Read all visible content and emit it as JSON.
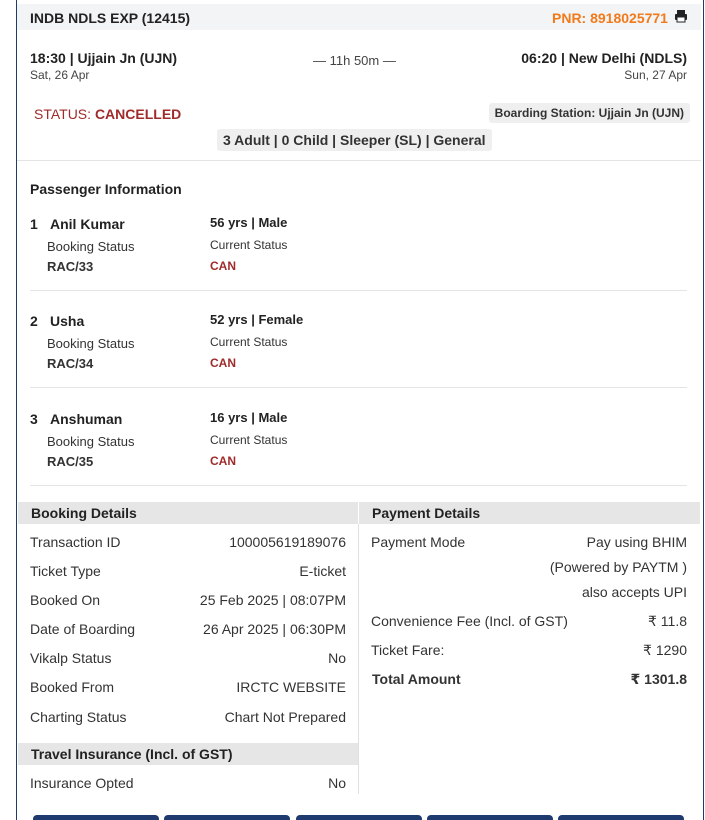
{
  "header": {
    "train": "INDB NDLS EXP (12415)",
    "pnr": "PNR: 8918025771"
  },
  "journey": {
    "from": "18:30 | Ujjain Jn (UJN)",
    "from_date": "Sat, 26 Apr",
    "duration": "— 11h 50m —",
    "to": "06:20 | New Delhi (NDLS)",
    "to_date": "Sun, 27 Apr"
  },
  "status": {
    "label": "STATUS:",
    "value": "CANCELLED",
    "boarding": "Boarding Station: Ujjain Jn (UJN)",
    "summary": "3 Adult | 0 Child | Sleeper (SL) | General"
  },
  "passenger_section": {
    "title": "Passenger Information",
    "passengers": [
      {
        "num": "1",
        "name": "Anil Kumar",
        "age_gender": "56 yrs | Male",
        "booking_label": "Booking Status",
        "booking": "RAC/33",
        "current_label": "Current Status",
        "current": "CAN"
      },
      {
        "num": "2",
        "name": "Usha",
        "age_gender": "52 yrs | Female",
        "booking_label": "Booking Status",
        "booking": "RAC/34",
        "current_label": "Current Status",
        "current": "CAN"
      },
      {
        "num": "3",
        "name": "Anshuman",
        "age_gender": "16 yrs | Male",
        "booking_label": "Booking Status",
        "booking": "RAC/35",
        "current_label": "Current Status",
        "current": "CAN"
      }
    ]
  },
  "booking": {
    "title": "Booking Details",
    "rows": [
      {
        "label": "Transaction ID",
        "value": "100005619189076"
      },
      {
        "label": "Ticket Type",
        "value": "E-ticket"
      },
      {
        "label": "Booked On",
        "value": "25 Feb 2025 | 08:07PM"
      },
      {
        "label": "Date of Boarding",
        "value": "26 Apr 2025 | 06:30PM"
      },
      {
        "label": "Vikalp Status",
        "value": "No"
      },
      {
        "label": "Booked From",
        "value": "IRCTC WEBSITE"
      },
      {
        "label": "Charting Status",
        "value": "Chart Not Prepared"
      }
    ]
  },
  "payment": {
    "title": "Payment Details",
    "mode_label": "Payment Mode",
    "mode_line1": "Pay using BHIM",
    "mode_line2": "(Powered by PAYTM )",
    "mode_line3": "also accepts UPI",
    "fee_label": "Convenience Fee (Incl. of GST)",
    "fee_value": "₹ 11.8",
    "fare_label": "Ticket Fare:",
    "fare_value": "₹ 1290",
    "total_label": "Total Amount",
    "total_value": "₹ 1301.8"
  },
  "insurance": {
    "title": "Travel Insurance (Incl. of GST)",
    "label": "Insurance Opted",
    "value": "No"
  },
  "colors": {
    "accent_orange": "#f27a1a",
    "status_red": "#a02b2b",
    "frame_blue": "#1f3a6e"
  },
  "icons": {
    "print": "printer-icon"
  }
}
